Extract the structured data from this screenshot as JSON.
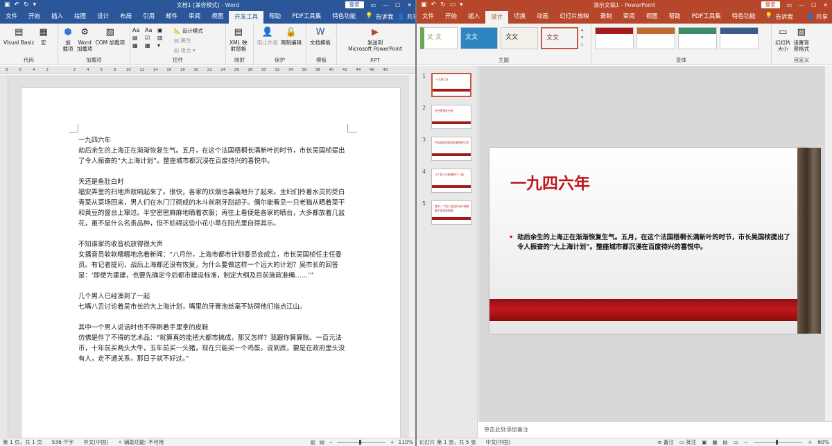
{
  "word": {
    "title": "文档1 [兼容模式] - Word",
    "login_label": "登录",
    "tabs": [
      "文件",
      "开始",
      "插入",
      "绘图",
      "设计",
      "布局",
      "引用",
      "邮件",
      "审阅",
      "视图",
      "开发工具",
      "帮助",
      "PDF工具集",
      "特色功能"
    ],
    "active_tab": "开发工具",
    "tell_me": "告诉我",
    "share": "共享",
    "ribbon": {
      "groups": [
        "代码",
        "加载项",
        "控件",
        "映射",
        "保护",
        "模板",
        "PPT"
      ],
      "visual_basic": "Visual Basic",
      "macro": "宏",
      "addins": "加\n载项",
      "word_addins": "Word\n加载项",
      "com_addins": "COM 加载项",
      "design_mode": "设计模式",
      "properties": "属性",
      "group": "组合",
      "xml_mapping": "XML 映\n射窗格",
      "block_authors": "阻止作者",
      "restrict_editing": "限制编辑",
      "doc_template": "文档模板",
      "send_ppt": "发送到\nMicrosoft PowerPoint"
    },
    "ruler_ticks": [
      "8",
      "6",
      "4",
      "2",
      "",
      "2",
      "4",
      "6",
      "8",
      "10",
      "12",
      "14",
      "16",
      "18",
      "20",
      "22",
      "24",
      "26",
      "28",
      "30",
      "32",
      "34",
      "36",
      "38",
      "40",
      "42",
      "44",
      "46",
      "48"
    ],
    "doc": {
      "p1_title": "一九四六年",
      "p1_body": "劫后余生的上海正在渐渐恢复生气。五月，在这个法国梧桐长满新叶的时节，市长吴国桢提出了令人振奋的“大上海计划”。整座城市都沉浸在百废待兴的喜悦中。",
      "p2_title": "天还是鱼肚白时",
      "p2_body": "福安弄里的扫地声就响起来了。很快，各家的炊烟也袅袅地升了起来。主妇们拎着水灵的茭白青菜从菜场回来，男人们在水门汀砌成的水斗前刷牙刮胡子。偶尔能看见一只老猫从晒着菜干和黄豆的窗台上窜过。半空密密麻麻地晒着衣服；再往上看便是各家的晒台，大多都放着几盆花，虽不是什么名贵品种，但不妨碍这些小花小草在阳光里自得其乐。",
      "p3_title": "不知谁家的收音机放得很大声",
      "p3_body": "女播音员软软糯糯地念着新闻：“八月份，上海市都市计划委员会成立，市长吴国桢任主任委员。有记者提问，战后上海都还没有恢复，为什么要做这样一个远大的计划？吴市长的回答是：‘即使为重建，也要先确定今后都市建设标准，制定大纲及目前施政准绳……’”",
      "p4_title": "几个男人已经凑到了一起",
      "p4_body": "七嘴八舌讨论着吴市长的大上海计划，嘴里的牙膏泡丝毫不妨碍他们指点江山。",
      "p5_title": "其中一个男人说话时也不停刷着手里拿的皮鞋",
      "p5_body": "仿佛是件了不得的艺术品：“就算真的能把大都市搞成，那又怎样？我跟你算算账。一百元法币，十年前买两头大牛，五年前买一头猪，现在只能买一个鸡蛋。说到底，要是在政府里头没有人，走不通关系，那日子就不好过。”"
    },
    "status": {
      "page": "第 1 页，共 1 页",
      "words": "536 个字",
      "language": "中文(中国)",
      "accessibility": "辅助功能: 不可用",
      "zoom": "110%"
    }
  },
  "ppt": {
    "title": "演示文稿1 - PowerPoint",
    "login_label": "登录",
    "tabs": [
      "文件",
      "开始",
      "插入",
      "设计",
      "切换",
      "动画",
      "幻灯片放映",
      "录制",
      "审阅",
      "视图",
      "帮助",
      "PDF工具集",
      "特色功能"
    ],
    "active_tab": "设计",
    "tell_me": "告诉我",
    "share": "共享",
    "ribbon": {
      "themes_label": "主题",
      "variants_label": "变体",
      "customize_label": "自定义",
      "theme_texts": [
        "文 文",
        "文文",
        "文文",
        "文文"
      ],
      "slide_size": "幻灯片\n大小",
      "format_bg": "设置背\n景格式"
    },
    "thumbnails": [
      {
        "num": "1",
        "text": "一九四六年"
      },
      {
        "num": "2",
        "text": "天还是鱼肚白时"
      },
      {
        "num": "3",
        "text": "不知谁家的收音机放得很大声"
      },
      {
        "num": "4",
        "text": "几个男人已经凑到了一起"
      },
      {
        "num": "5",
        "text": "其中一个男人说话时也不停刷着手里拿的皮鞋"
      }
    ],
    "slide": {
      "title": "一九四六年",
      "body": "劫后余生的上海正在渐渐恢复生气。五月，在这个法国梧桐长满新叶的时节，市长吴国桢提出了令人振奋的“大上海计划”。整座城市都沉浸在百废待兴的喜悦中。"
    },
    "notes_placeholder": "单击此处添加备注",
    "status": {
      "slide": "幻灯片 第 1 张，共 5 张",
      "language": "中文(中国)",
      "notes": "备注",
      "comments": "批注",
      "zoom": "60%"
    }
  },
  "colors": {
    "word_brand": "#2b579a",
    "ppt_brand": "#b7472a",
    "slide_accent": "#c0141c"
  }
}
